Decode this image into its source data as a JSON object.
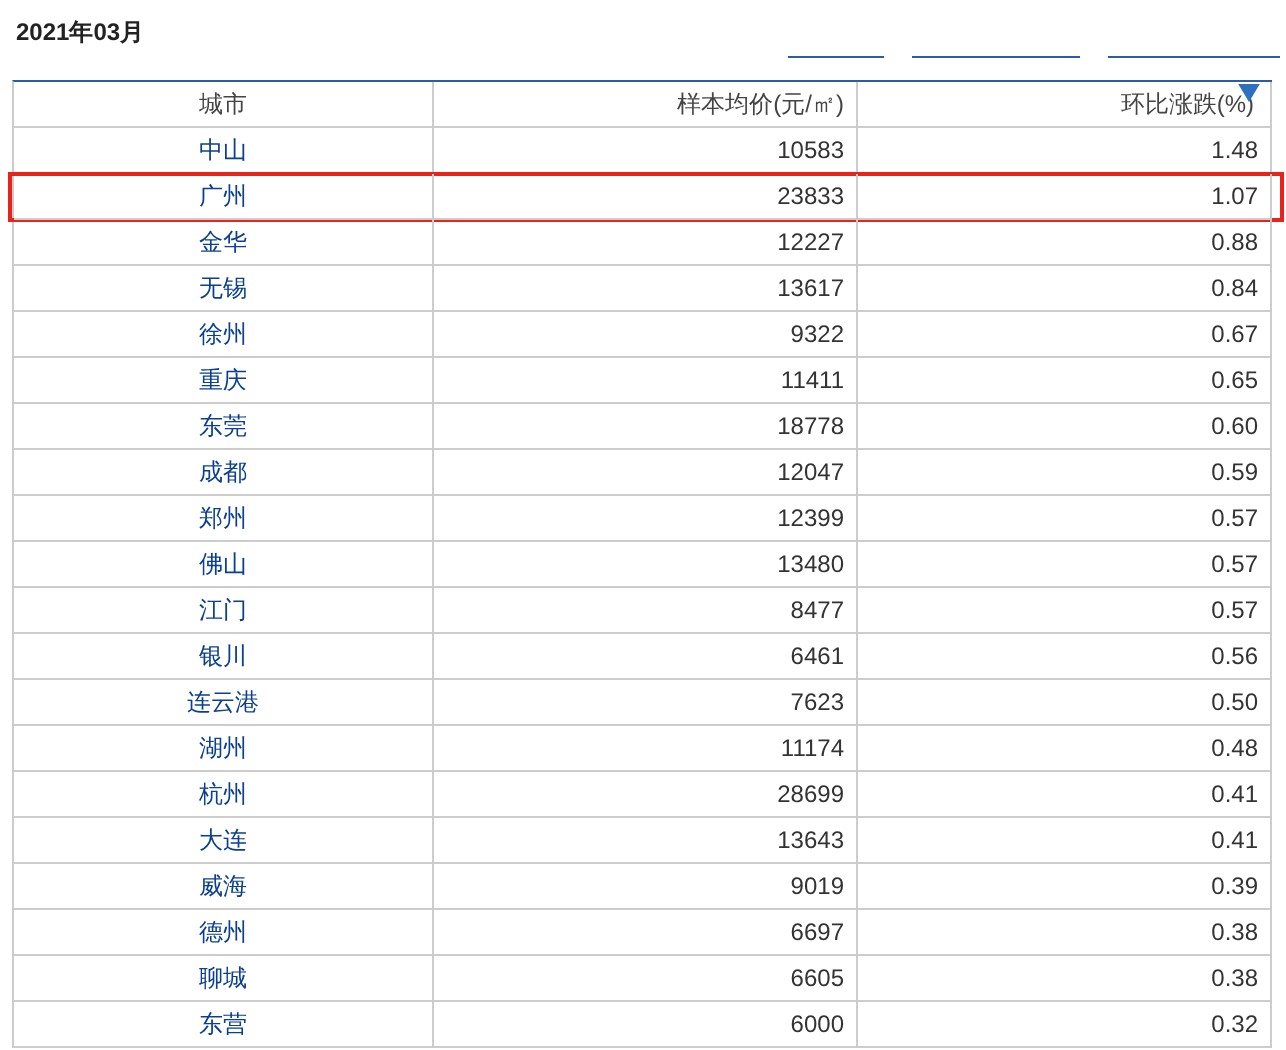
{
  "title": "2021年03月",
  "table": {
    "columns": [
      {
        "label": "城市",
        "sorted": false
      },
      {
        "label": "样本均价(元/㎡)",
        "sorted": false
      },
      {
        "label": "环比涨跌(%)",
        "sorted": true
      }
    ],
    "rows": [
      {
        "city": "中山",
        "price": "10583",
        "change": "1.48",
        "highlighted": false
      },
      {
        "city": "广州",
        "price": "23833",
        "change": "1.07",
        "highlighted": true
      },
      {
        "city": "金华",
        "price": "12227",
        "change": "0.88",
        "highlighted": false
      },
      {
        "city": "无锡",
        "price": "13617",
        "change": "0.84",
        "highlighted": false
      },
      {
        "city": "徐州",
        "price": "9322",
        "change": "0.67",
        "highlighted": false
      },
      {
        "city": "重庆",
        "price": "11411",
        "change": "0.65",
        "highlighted": false
      },
      {
        "city": "东莞",
        "price": "18778",
        "change": "0.60",
        "highlighted": false
      },
      {
        "city": "成都",
        "price": "12047",
        "change": "0.59",
        "highlighted": false
      },
      {
        "city": "郑州",
        "price": "12399",
        "change": "0.57",
        "highlighted": false
      },
      {
        "city": "佛山",
        "price": "13480",
        "change": "0.57",
        "highlighted": false
      },
      {
        "city": "江门",
        "price": "8477",
        "change": "0.57",
        "highlighted": false
      },
      {
        "city": "银川",
        "price": "6461",
        "change": "0.56",
        "highlighted": false
      },
      {
        "city": "连云港",
        "price": "7623",
        "change": "0.50",
        "highlighted": false
      },
      {
        "city": "湖州",
        "price": "11174",
        "change": "0.48",
        "highlighted": false
      },
      {
        "city": "杭州",
        "price": "28699",
        "change": "0.41",
        "highlighted": false
      },
      {
        "city": "大连",
        "price": "13643",
        "change": "0.41",
        "highlighted": false
      },
      {
        "city": "威海",
        "price": "9019",
        "change": "0.39",
        "highlighted": false
      },
      {
        "city": "德州",
        "price": "6697",
        "change": "0.38",
        "highlighted": false
      },
      {
        "city": "聊城",
        "price": "6605",
        "change": "0.38",
        "highlighted": false
      },
      {
        "city": "东营",
        "price": "6000",
        "change": "0.32",
        "highlighted": false
      }
    ]
  }
}
